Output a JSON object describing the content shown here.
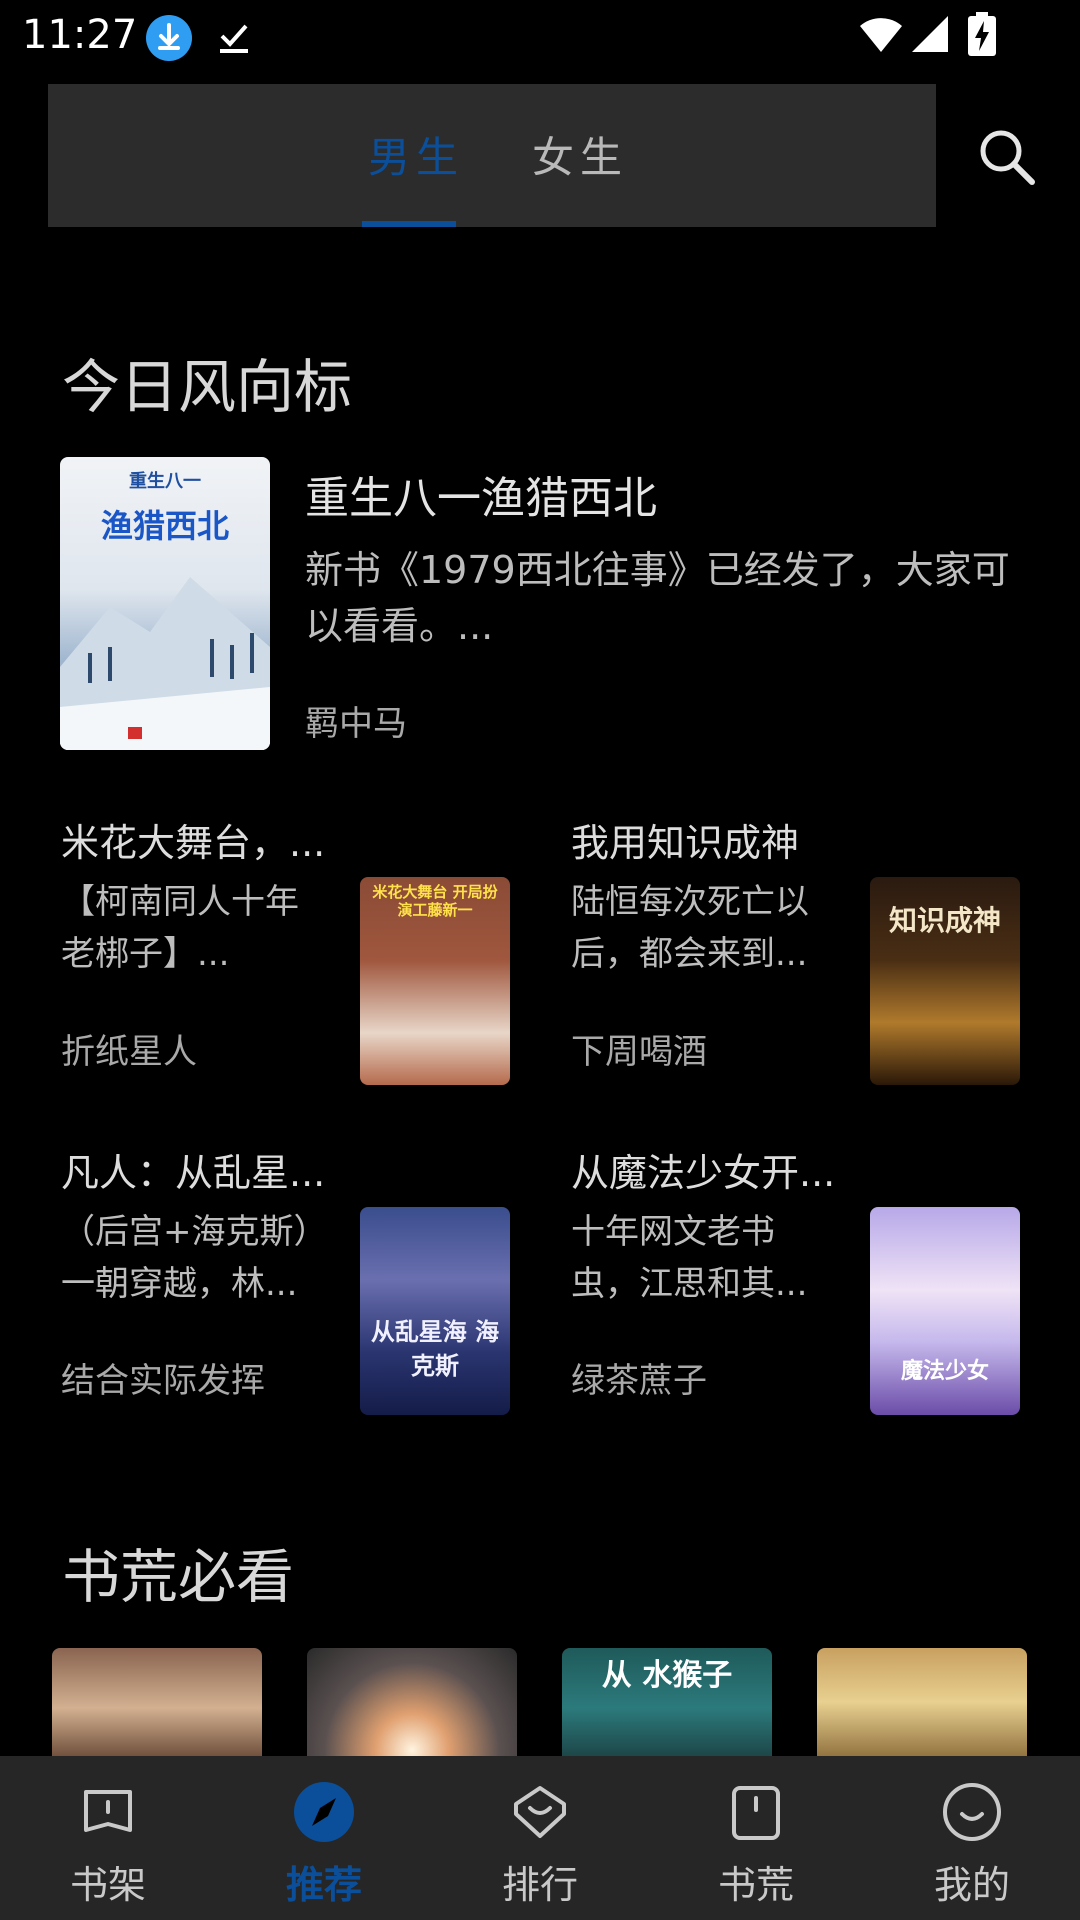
{
  "status": {
    "time": "11:27"
  },
  "tabs": [
    {
      "label": "男生",
      "active": true
    },
    {
      "label": "女生",
      "active": false
    }
  ],
  "sections": {
    "today_title": "今日风向标",
    "must_read_title": "书荒必看"
  },
  "featured": {
    "title": "重生八一渔猎西北",
    "description": "新书《1979西北往事》已经发了，大家可以看看。...",
    "author": "羁中马",
    "cover_text_top": "重生八一",
    "cover_text_main": "渔猎西北"
  },
  "cards": [
    {
      "title": "米花大舞台，...",
      "description": "【柯南同人十年老梆子】...",
      "author": "折纸星人",
      "cover_text": "米花大舞台 开局扮演工藤新一"
    },
    {
      "title": "我用知识成神",
      "description": "陆恒每次死亡以后，都会来到...",
      "author": "下周喝酒",
      "cover_text": "知识成神"
    },
    {
      "title": "凡人：从乱星...",
      "description": "（后宫+海克斯）一朝穿越，林...",
      "author": "结合实际发挥",
      "cover_text": "从乱星海 海克斯"
    },
    {
      "title": "从魔法少女开...",
      "description": "十年网文老书虫，江思和其...",
      "author": "绿茶蔗子",
      "cover_text": "魔法少女"
    }
  ],
  "must_read_cover_texts": [
    "",
    "",
    "从 水猴子",
    ""
  ],
  "bottom_nav": [
    {
      "label": "书架",
      "icon": "bookshelf-icon",
      "active": false
    },
    {
      "label": "推荐",
      "icon": "compass-icon",
      "active": true
    },
    {
      "label": "排行",
      "icon": "ranking-icon",
      "active": false
    },
    {
      "label": "书荒",
      "icon": "book-famine-icon",
      "active": false
    },
    {
      "label": "我的",
      "icon": "profile-icon",
      "active": false
    }
  ],
  "colors": {
    "accent": "#0b4f9a",
    "background": "#000000",
    "tab_bar": "#2c2c2c",
    "bottom_nav": "#262626"
  }
}
